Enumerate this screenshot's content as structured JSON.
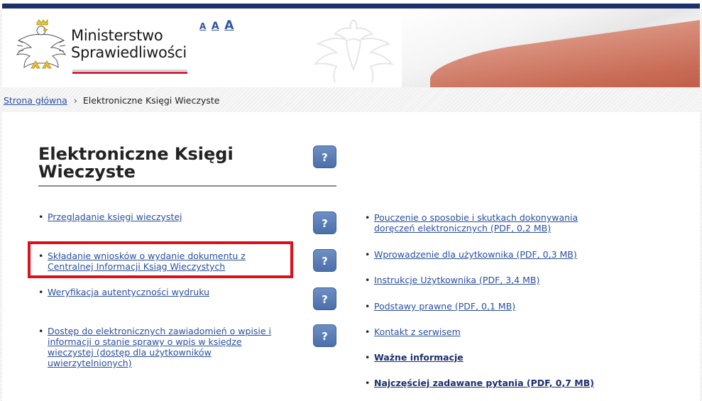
{
  "header": {
    "logo_line1": "Ministerstwo",
    "logo_line2": "Sprawiedliwości",
    "font_size_controls": [
      "A",
      "A",
      "A"
    ]
  },
  "breadcrumb": {
    "home": "Strona główna",
    "separator": "›",
    "current": "Elektroniczne Księgi Wieczyste"
  },
  "main": {
    "title": "Elektroniczne Księgi Wieczyste",
    "help_label": "?",
    "left_items": [
      {
        "bullet": "•",
        "label": "Przeglądanie księgi wieczystej"
      },
      {
        "bullet": "•",
        "label": "Składanie wniosków o wydanie dokumentu z Centralnej Informacji Ksiąg Wieczystych"
      },
      {
        "bullet": "•",
        "label": "Weryfikacja autentyczności wydruku"
      },
      {
        "bullet": "•",
        "label": "Dostęp do elektronicznych zawiadomień o wpisie i informacji o stanie sprawy o wpis w księdze wieczystej (dostęp dla użytkowników uwierzytelnionych)"
      }
    ],
    "right_items": [
      {
        "bullet": "•",
        "label": "Pouczenie o sposobie i skutkach dokonywania doręczeń elektronicznych (PDF, 0,2 MB)"
      },
      {
        "bullet": "•",
        "label": "Wprowadzenie dla użytkownika (PDF, 0,3 MB)"
      },
      {
        "bullet": "•",
        "label": "Instrukcje Użytkownika (PDF, 3,4 MB)"
      },
      {
        "bullet": "•",
        "label": "Podstawy prawne (PDF, 0,1 MB)"
      },
      {
        "bullet": "•",
        "label": "Kontakt z serwisem"
      },
      {
        "bullet": "•",
        "label": "Ważne informacje"
      },
      {
        "bullet": "•",
        "label": "Najczęściej zadawane pytania (PDF, 0,7 MB)"
      }
    ]
  },
  "colors": {
    "link": "#2a4f9e",
    "top_bar": "#1b2f6b",
    "help_button": "#5878b3",
    "highlight": "#e0101a",
    "accent_red": "#d4213d"
  },
  "icons": {
    "logo": "polish-eagle-icon",
    "help": "question-mark-icon",
    "breadcrumb_separator": "chevron-right-icon"
  }
}
